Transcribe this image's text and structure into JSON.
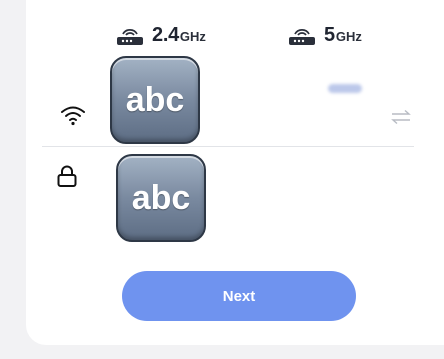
{
  "bands": [
    {
      "number": "2.4",
      "unit": "GHz",
      "icon": "router-icon"
    },
    {
      "number": "5",
      "unit": "GHz",
      "icon": "router-icon"
    }
  ],
  "ssid_row": {
    "icon": "wifi-icon",
    "field_text": "abc",
    "swap_icon": "swap-icon"
  },
  "password_row": {
    "icon": "lock-icon",
    "field_text": "abc"
  },
  "next_button": {
    "label": "Next"
  },
  "colors": {
    "accent": "#6f93ef",
    "text": "#1f2430",
    "background": "#f2f2f4",
    "card": "#ffffff"
  }
}
